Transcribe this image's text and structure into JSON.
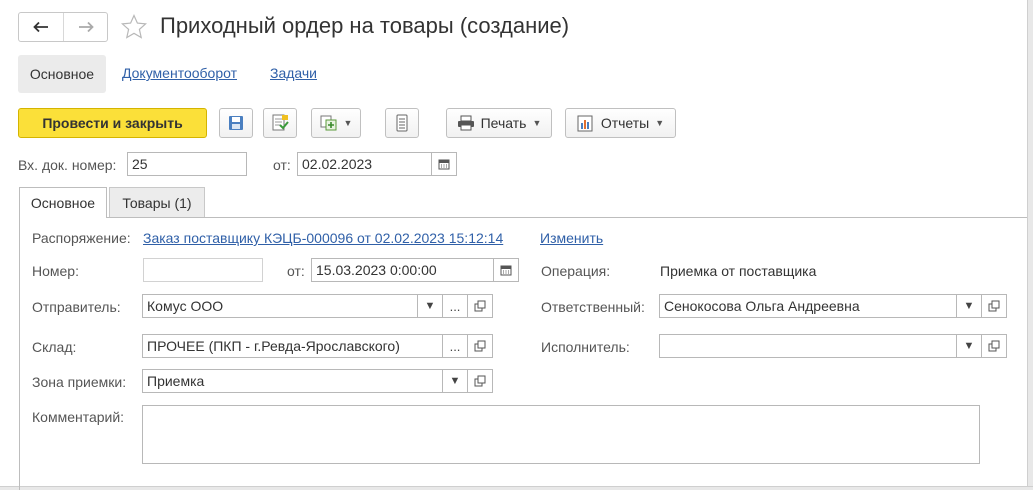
{
  "window": {
    "title": "Приходный ордер на товары (создание)"
  },
  "nav": {
    "back_icon": "arrow-left-icon",
    "forward_icon": "arrow-right-icon",
    "favorite_icon": "star-icon"
  },
  "top_tabs": {
    "main": "Основное",
    "docflow": "Документооборот",
    "tasks": "Задачи"
  },
  "toolbar": {
    "post_close": "Провести и закрыть",
    "print": "Печать",
    "reports": "Отчеты"
  },
  "header_fields": {
    "incoming_number_label": "Вх. док. номер:",
    "incoming_number_value": "25",
    "from_label": "от:",
    "from_value": "02.02.2023"
  },
  "tabs": {
    "main": "Основное",
    "goods": "Товары (1)"
  },
  "form": {
    "order_label": "Распоряжение:",
    "order_link": "Заказ поставщику КЭЦБ-000096 от 02.02.2023 15:12:14",
    "change_link": "Изменить",
    "number_label": "Номер:",
    "number_value": "",
    "date_label": "от:",
    "date_value": "15.03.2023  0:00:00",
    "operation_label": "Операция:",
    "operation_value": "Приемка от поставщика",
    "sender_label": "Отправитель:",
    "sender_value": "Комус ООО",
    "responsible_label": "Ответственный:",
    "responsible_value": "Сенокосова Ольга Андреевна",
    "warehouse_label": "Склад:",
    "warehouse_value": "ПРОЧЕЕ (ПКП - г.Ревда-Ярославского)",
    "executor_label": "Исполнитель:",
    "executor_value": "",
    "zone_label": "Зона приемки:",
    "zone_value": "Приемка",
    "comment_label": "Комментарий:",
    "comment_value": ""
  },
  "colors": {
    "primary_button": "#fbe039",
    "link": "#3060a8"
  }
}
